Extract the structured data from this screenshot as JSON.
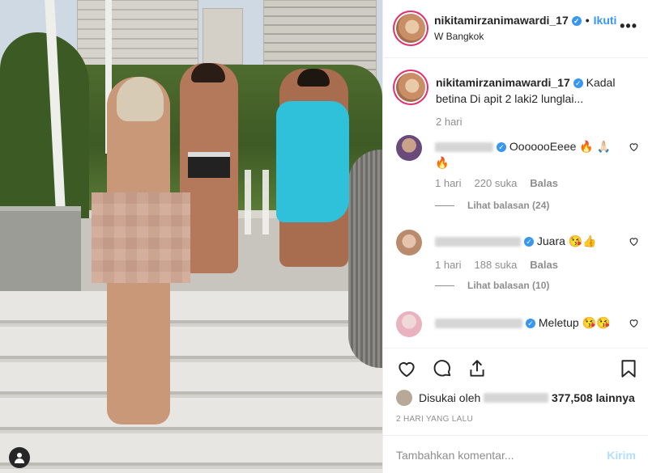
{
  "header": {
    "username": "nikitamirzanimawardi_17",
    "verified_glyph": "✓",
    "separator": "•",
    "follow_label": "Ikuti",
    "location": "W Bangkok",
    "more_glyph": "•••"
  },
  "caption": {
    "username": "nikitamirzanimawardi_17",
    "text": "Kadal betina Di apit 2 laki2 lunglai...",
    "time": "2 hari"
  },
  "comments": [
    {
      "text": "OoooooEeee 🔥 🙏🏻 🔥",
      "time": "1 hari",
      "likes": "220 suka",
      "reply": "Balas",
      "view_replies": "Lihat balasan (24)"
    },
    {
      "text": "Juara 😘👍",
      "time": "1 hari",
      "likes": "188 suka",
      "reply": "Balas",
      "view_replies": "Lihat balasan (10)"
    },
    {
      "text": "Meletup 😘😘",
      "time": "",
      "likes": "",
      "reply": "",
      "view_replies": ""
    }
  ],
  "likes": {
    "prefix": "Disukai oleh",
    "count": "377,508",
    "suffix": "lainnya"
  },
  "posted": "2 HARI YANG LALU",
  "add_comment": {
    "placeholder": "Tambahkan komentar...",
    "post_label": "Kirim"
  },
  "icons": {
    "like": "heart-icon",
    "comment": "comment-icon",
    "share": "share-icon",
    "save": "bookmark-icon",
    "tag": "user-tag-icon"
  },
  "colors": {
    "accent": "#3897f0",
    "muted": "#8e8e8e",
    "post_disabled": "#b2dffc",
    "towel": "#2ec1d9"
  }
}
